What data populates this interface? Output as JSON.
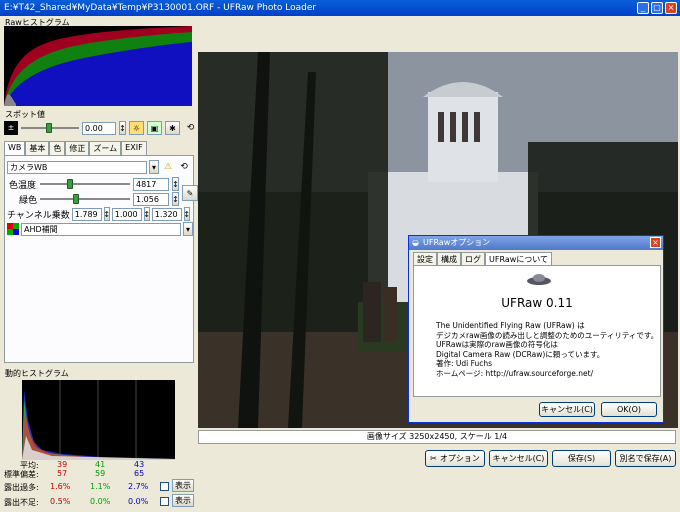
{
  "window": {
    "title": "E:¥T42_Shared¥MyData¥Temp¥P3130001.ORF - UFRaw Photo Loader",
    "min": "_",
    "max": "□",
    "close": "×"
  },
  "raw_hist": {
    "label": "Rawヒストグラム"
  },
  "spot": {
    "label": "スポット値",
    "exposure_value": "0.00"
  },
  "tabs": [
    "WB",
    "基本",
    "色",
    "修正",
    "ズーム",
    "EXIF"
  ],
  "wb": {
    "preset": "カメラWB",
    "temp_label": "色温度",
    "temp_value": "4817",
    "green_label": "緑色",
    "green_value": "1.056",
    "channel_label": "チャンネル乗数",
    "ch1": "1.789",
    "ch2": "1.000",
    "ch3": "1.320",
    "interp": "AHD補間"
  },
  "live_hist": {
    "label": "動的ヒストグラム",
    "rows": [
      {
        "label": "平均:",
        "r": "39",
        "g": "41",
        "b": "43"
      },
      {
        "label": "標準偏差:",
        "r": "57",
        "g": "59",
        "b": "65"
      },
      {
        "label": "露出過多:",
        "r": "1.6%",
        "g": "1.1%",
        "b": "2.7%",
        "btn": "表示"
      },
      {
        "label": "露出不足:",
        "r": "0.5%",
        "g": "0.0%",
        "b": "0.0%",
        "btn": "表示"
      }
    ]
  },
  "status": "画像サイズ 3250x2450, スケール 1/4",
  "buttons": {
    "options": "オプション",
    "cancel": "キャンセル(C)",
    "save": "保存(S)",
    "save_as": "別名で保存(A)"
  },
  "dialog": {
    "title": "UFRawオプション",
    "tabs": [
      "設定",
      "構成",
      "ログ",
      "UFRawについて"
    ],
    "app_name": "UFRaw 0.11",
    "lines": [
      "The Unidentified Flying Raw (UFRaw) は",
      "デジカメraw画像の読み出しと調整のためのユーティリティです。",
      "UFRawは実際のraw画像の符号化は",
      "Digital Camera Raw (DCRaw)に頼っています。",
      "著作: Udi Fuchs",
      "ホームページ: http://ufraw.sourceforge.net/"
    ],
    "cancel": "キャンセル(C)",
    "ok": "OK(O)"
  },
  "colors": {
    "title_bar": "#0054e3",
    "green_text": "#00a000"
  }
}
